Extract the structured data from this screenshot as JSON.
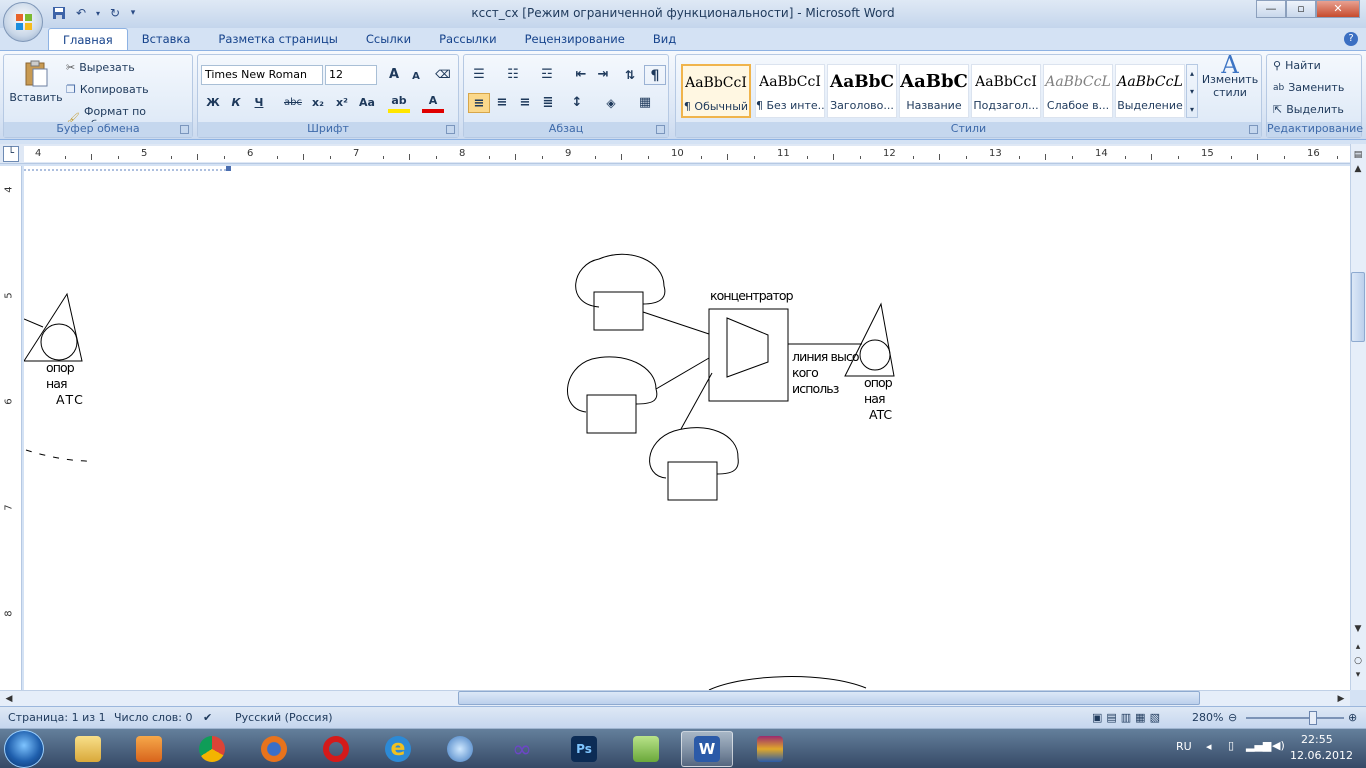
{
  "window": {
    "title": "ксст_сх [Режим ограниченной функциональности] - Microsoft Word",
    "controls": {
      "minimize": "—",
      "maximize": "▫",
      "close": "✕"
    }
  },
  "qat": {
    "save": "save-icon",
    "undo": "undo-icon",
    "redo": "redo-icon",
    "customize": "▾"
  },
  "tabs": [
    "Главная",
    "Вставка",
    "Разметка страницы",
    "Ссылки",
    "Рассылки",
    "Рецензирование",
    "Вид"
  ],
  "ribbon": {
    "clipboard": {
      "label": "Буфер обмена",
      "paste": "Вставить",
      "cut": "Вырезать",
      "copy": "Копировать",
      "format_painter": "Формат по образцу"
    },
    "font": {
      "label": "Шрифт",
      "family": "Times New Roman",
      "size": "12",
      "grow": "A",
      "shrink": "A",
      "bold": "Ж",
      "italic": "К",
      "underline": "Ч",
      "strike": "abc",
      "subscript": "x₂",
      "superscript": "x²",
      "case": "Aa",
      "highlight": "ab",
      "color": "A"
    },
    "paragraph": {
      "label": "Абзац",
      "show_marks": "¶"
    },
    "styles": {
      "label": "Стили",
      "items": [
        {
          "preview": "AaBbCcI",
          "name": "¶ Обычный"
        },
        {
          "preview": "AaBbCcI",
          "name": "¶ Без инте..."
        },
        {
          "preview": "AaBbC",
          "name": "Заголово..."
        },
        {
          "preview": "AaBbC",
          "name": "Название"
        },
        {
          "preview": "AaBbCcI",
          "name": "Подзагол..."
        },
        {
          "preview": "AaBbCcL",
          "name": "Слабое в..."
        },
        {
          "preview": "AaBbCcL",
          "name": "Выделение"
        }
      ],
      "change_styles": "Изменить стили"
    },
    "editing": {
      "label": "Редактирование",
      "find": "Найти",
      "replace": "Заменить",
      "select": "Выделить"
    }
  },
  "ruler": {
    "horizontal": [
      "4",
      "5",
      "6",
      "7",
      "8",
      "9",
      "10",
      "11",
      "12",
      "13",
      "14",
      "15",
      "16"
    ],
    "vertical": [
      "4",
      "5",
      "6",
      "7",
      "8"
    ]
  },
  "document": {
    "left_station": {
      "line1": "опор",
      "line2": "ная",
      "line3": "АТС"
    },
    "concentrator": "концентратор",
    "line_label": {
      "line1": "линия высо",
      "line2": "кого",
      "line3": "использ"
    },
    "right_station": {
      "line1": "опор",
      "line2": "ная",
      "line3": "АТС"
    }
  },
  "statusbar": {
    "page": "Страница: 1 из 1",
    "words": "Число слов: 0",
    "language": "Русский (Россия)",
    "zoom": "280%"
  },
  "taskbar": {
    "lang": "RU",
    "time": "22:55",
    "date": "12.06.2012",
    "word_label": "W"
  }
}
